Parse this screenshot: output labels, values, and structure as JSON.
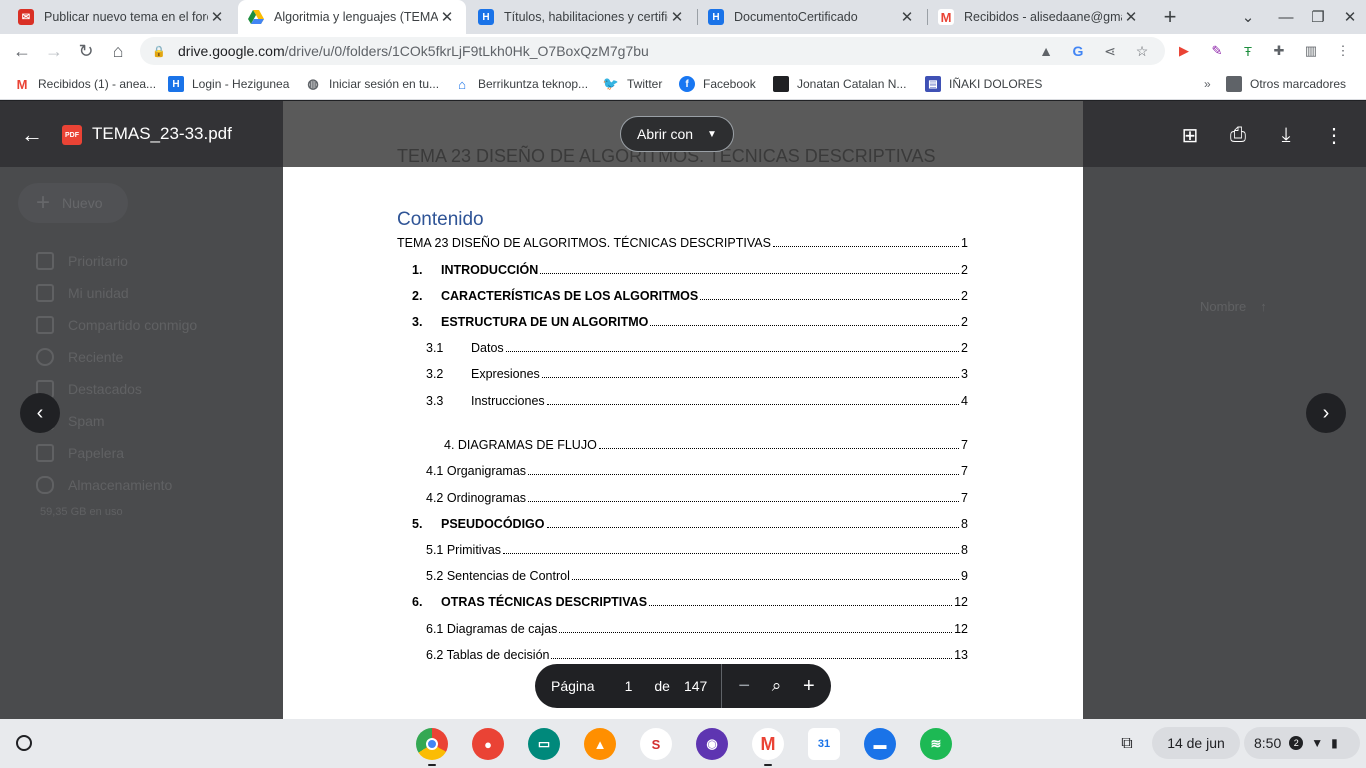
{
  "tabs": [
    {
      "title": "Publicar nuevo tema en el foro",
      "icon": "moodle-icon",
      "active": false
    },
    {
      "title": "Algoritmia y lenguajes (TEMAS)",
      "icon": "google-drive-icon",
      "active": true
    },
    {
      "title": "Títulos, habilitaciones y certificados",
      "icon": "hezigunea-icon",
      "active": false
    },
    {
      "title": "DocumentoCertificado",
      "icon": "hezigunea-icon",
      "active": false
    },
    {
      "title": "Recibidos - alisedaane@gmail.com",
      "icon": "gmail-icon",
      "active": false
    }
  ],
  "address": {
    "host": "drive.google.com",
    "path": "/drive/u/0/folders/1COk5fkrLjF9tLkh0Hk_O7BoxQzM7g7bu"
  },
  "bookmarks": [
    {
      "label": "Recibidos (1) - anea...",
      "icon": "gmail-icon"
    },
    {
      "label": "Login - Hezigunea",
      "icon": "hezigunea-icon"
    },
    {
      "label": "Iniciar sesión en tu...",
      "icon": "globe-icon"
    },
    {
      "label": "Berrikuntza teknop...",
      "icon": "home-icon"
    },
    {
      "label": "Twitter",
      "icon": "twitter-icon"
    },
    {
      "label": "Facebook",
      "icon": "facebook-icon"
    },
    {
      "label": "Jonatan Catalan N...",
      "icon": "square-icon"
    },
    {
      "label": "IÑAKI DOLORES",
      "icon": "calendar-icon"
    }
  ],
  "other_bookmarks": "Otros marcadores",
  "drive": {
    "new_label": "Nuevo",
    "sidebar": [
      "Prioritario",
      "Mi unidad",
      "Compartido conmigo",
      "Reciente",
      "Destacados",
      "Spam",
      "Papelera",
      "Almacenamiento"
    ],
    "storage": "59,35 GB en uso",
    "sort_label": "Nombre"
  },
  "viewer": {
    "file_name": "TEMAS_23-33.pdf",
    "open_with": "Abrir con",
    "doc_ghost_title": "TEMA 23 DISEÑO DE ALGORITMOS. TÉCNICAS DESCRIPTIVAS",
    "toc_heading": "Contenido",
    "toc": [
      {
        "num": "",
        "text": "TEMA 23 DISEÑO DE ALGORITMOS. TÉCNICAS DESCRIPTIVAS",
        "page": "1"
      },
      {
        "num": "1.",
        "text": "INTRODUCCIÓN",
        "page": "2"
      },
      {
        "num": "2.",
        "text": "CARACTERÍSTICAS DE LOS ALGORITMOS",
        "page": "2"
      },
      {
        "num": "3.",
        "text": "ESTRUCTURA DE UN ALGORITMO",
        "page": "2"
      },
      {
        "num": "3.1",
        "text": "Datos",
        "page": "2"
      },
      {
        "num": "3.2",
        "text": "Expresiones",
        "page": "3"
      },
      {
        "num": "3.3",
        "text": "Instrucciones",
        "page": "4"
      },
      {
        "num": "",
        "text": "4. DIAGRAMAS DE FLUJO",
        "page": "7"
      },
      {
        "num": "",
        "text": "4.1 Organigramas",
        "page": "7"
      },
      {
        "num": "",
        "text": "4.2 Ordinogramas",
        "page": "7"
      },
      {
        "num": "5.",
        "text": "PSEUDOCÓDIGO",
        "page": "8"
      },
      {
        "num": "",
        "text": "5.1 Primitivas",
        "page": "8"
      },
      {
        "num": "",
        "text": "5.2 Sentencias de Control",
        "page": "9"
      },
      {
        "num": "6.",
        "text": "OTRAS TÉCNICAS DESCRIPTIVAS",
        "page": "12"
      },
      {
        "num": "",
        "text": "6.1 Diagramas de cajas",
        "page": "12"
      },
      {
        "num": "",
        "text": "6.2 Tablas de decisión",
        "page": "13"
      }
    ],
    "pager": {
      "label": "Página",
      "current": "1",
      "of": "de",
      "total": "147"
    }
  },
  "shelf": {
    "date": "14 de jun",
    "time": "8:50",
    "notifications": "2"
  }
}
